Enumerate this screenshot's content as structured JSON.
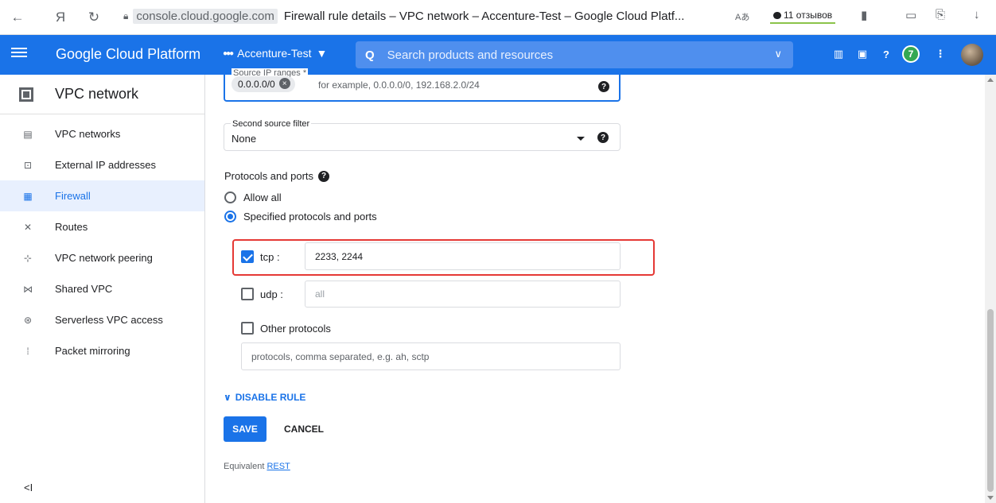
{
  "browser": {
    "back_icon": "←",
    "yandex_icon": "Я",
    "reload_icon": "↻",
    "domain": "console.cloud.google.com",
    "page_title": "Firewall rule details – VPC network – Accenture-Test – Google Cloud Platf...",
    "translate_icon": "Aあ",
    "reviews_label": "11 отзывов",
    "bookmark_icon": "▮",
    "battery_icon": "▭",
    "share_icon": "⎘",
    "download_icon": "↓"
  },
  "header": {
    "app_title": "Google Cloud Platform",
    "project_name": "Accenture-Test",
    "search_placeholder": "Search products and resources",
    "notifications_count": "7"
  },
  "sidebar": {
    "title": "VPC network",
    "items": [
      {
        "label": "VPC networks",
        "icon": "▤"
      },
      {
        "label": "External IP addresses",
        "icon": "⊡"
      },
      {
        "label": "Firewall",
        "icon": "▦"
      },
      {
        "label": "Routes",
        "icon": "✕"
      },
      {
        "label": "VPC network peering",
        "icon": "⊹"
      },
      {
        "label": "Shared VPC",
        "icon": "⋈"
      },
      {
        "label": "Serverless VPC access",
        "icon": "⊛"
      },
      {
        "label": "Packet mirroring",
        "icon": "⁞"
      }
    ],
    "active_item": "Firewall",
    "collapse_label": "<I"
  },
  "form": {
    "source_ip": {
      "label": "Source IP ranges *",
      "chip": "0.0.0.0/0",
      "placeholder": "for example, 0.0.0.0/0, 192.168.2.0/24"
    },
    "second_source": {
      "label": "Second source filter",
      "value": "None"
    },
    "protocols_title": "Protocols and ports",
    "radio_allow_all": "Allow all",
    "radio_specified": "Specified protocols and ports",
    "tcp": {
      "label": "tcp :",
      "value": "2233, 2244",
      "checked": true
    },
    "udp": {
      "label": "udp :",
      "placeholder": "all",
      "checked": false
    },
    "other": {
      "label": "Other protocols",
      "placeholder": "protocols, comma separated, e.g. ah, sctp",
      "checked": false
    },
    "disable_rule": "DISABLE RULE",
    "save": "SAVE",
    "cancel": "CANCEL",
    "equivalent": "Equivalent",
    "rest": "REST"
  },
  "colors": {
    "accent": "#1a73e8",
    "highlight": "#e53935"
  }
}
